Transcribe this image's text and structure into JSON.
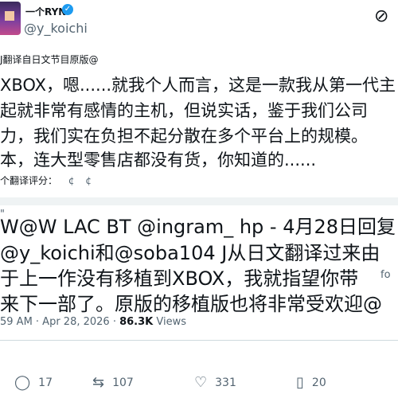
{
  "header": {
    "display_name": "一个RYN",
    "verified_icon": "verified-badge-icon",
    "handle": "@y_koichi",
    "top_right_icon": "more-icon"
  },
  "tweet": {
    "translation_tag": "J翻译自日文节目原版@",
    "body_lines": [
      "XBOX，嗯......就我个人而言，这是一款我从第一代主",
      "起就非常有感情的主机，但说实话，鉴于我们公司",
      "力，我们实在负担不起分散在多个平台上的规模。",
      "本，连大型零售店都没有货，你知道的......"
    ],
    "rate_label": "个翻译评分：",
    "rate_icons": [
      "thumbs-up-icon",
      "thumbs-down-icon"
    ]
  },
  "quote": {
    "mark": "\"",
    "lines": [
      "W@W LAC BT @ingram_ hp - 4月28日回复",
      "@y_koichi和@soba104 J从日文翻译过来由",
      "于上一作没有移植到XBOX，我就指望你带",
      "来下一部了。原版的移植版也将非常受欢迎@"
    ],
    "side_text": "fo"
  },
  "meta": {
    "time": "59 AM · Apr 28, 2026 · ",
    "views": "86.3K",
    "views_label": " Views"
  },
  "actions": {
    "reply_count": "17",
    "repost_count": "107",
    "like_count": "331",
    "bookmark_count": "20"
  }
}
